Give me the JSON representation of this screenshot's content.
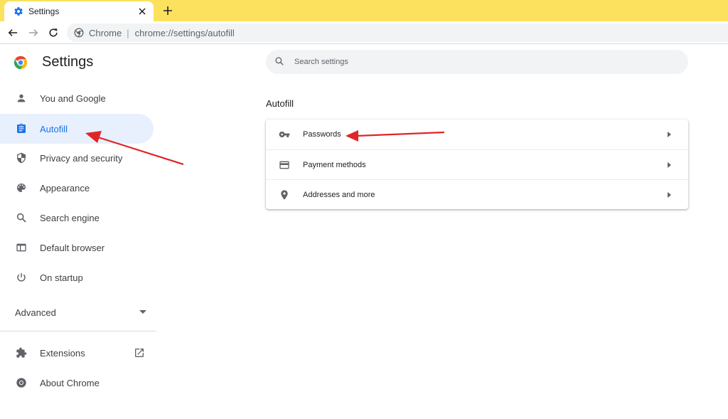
{
  "browser": {
    "tab": {
      "title": "Settings",
      "icon": "gear-icon"
    },
    "omnibox": {
      "chip": "Chrome",
      "separator": "|",
      "url": "chrome://settings/autofill"
    }
  },
  "sidebar": {
    "title": "Settings",
    "items": [
      {
        "label": "You and Google",
        "icon": "person-icon"
      },
      {
        "label": "Autofill",
        "icon": "clipboard-icon",
        "active": true
      },
      {
        "label": "Privacy and security",
        "icon": "shield-icon"
      },
      {
        "label": "Appearance",
        "icon": "palette-icon"
      },
      {
        "label": "Search engine",
        "icon": "search-icon"
      },
      {
        "label": "Default browser",
        "icon": "browser-window-icon"
      },
      {
        "label": "On startup",
        "icon": "power-icon"
      }
    ],
    "advanced_label": "Advanced",
    "footer_items": [
      {
        "label": "Extensions",
        "icon": "puzzle-icon"
      },
      {
        "label": "About Chrome",
        "icon": "chrome-logo-icon"
      }
    ]
  },
  "main": {
    "search_placeholder": "Search settings",
    "section_title": "Autofill",
    "rows": [
      {
        "label": "Passwords",
        "icon": "key-icon"
      },
      {
        "label": "Payment methods",
        "icon": "credit-card-icon"
      },
      {
        "label": "Addresses and more",
        "icon": "location-pin-icon"
      }
    ]
  },
  "colors": {
    "tabstrip": "#fbe15e",
    "accent": "#1a73e8",
    "active_bg": "#e8f0fe",
    "annotation_arrow": "#e02626"
  }
}
